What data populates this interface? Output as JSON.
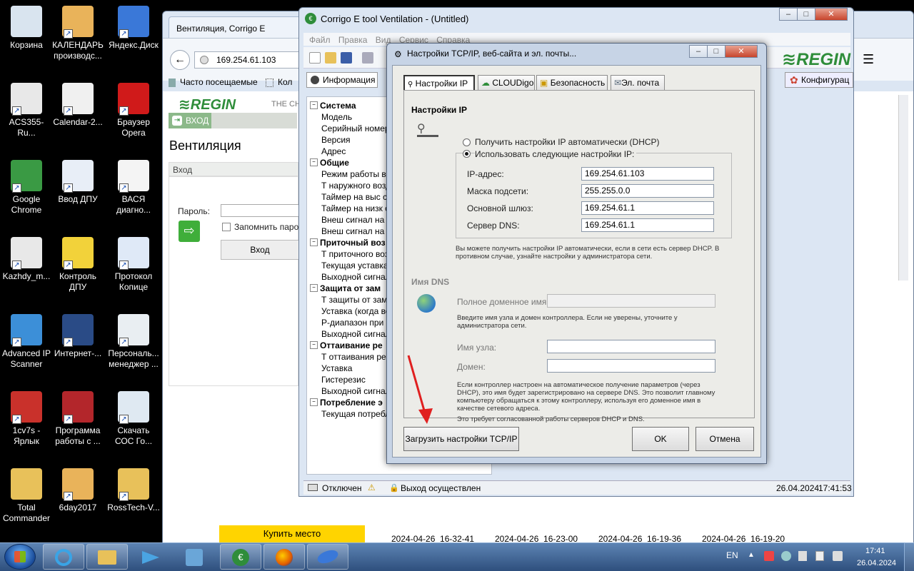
{
  "desktop": {
    "icons": [
      {
        "label": "Корзина",
        "icon": "recycle-bin-icon",
        "color": "#d9e4ef"
      },
      {
        "label": "КАЛЕНДАРЬ производс...",
        "icon": "calendar-icon",
        "color": "#e9b35a"
      },
      {
        "label": "Яндекс.Диск",
        "icon": "yandex-disk-icon",
        "color": "#3a78d8"
      },
      {
        "label": "ACS355-Ru...",
        "icon": "pdf-icon",
        "color": "#e8e8e8"
      },
      {
        "label": "Calendar-2...",
        "icon": "calendar-icon",
        "color": "#f0f0f0"
      },
      {
        "label": "Браузер Opera",
        "icon": "opera-icon",
        "color": "#d01a1a"
      },
      {
        "label": "Google Chrome",
        "icon": "chrome-icon",
        "color": "#3a9a44"
      },
      {
        "label": "Ввод ДПУ",
        "icon": "documents-icon",
        "color": "#e8eef7"
      },
      {
        "label": "ВАСЯ диагно...",
        "icon": "vasya-icon",
        "color": "#f4f4f4"
      },
      {
        "label": "Kazhdy_m...",
        "icon": "pdf-icon",
        "color": "#e8e8e8"
      },
      {
        "label": "Контроль ДПУ",
        "icon": "bee-icon",
        "color": "#f2d23a"
      },
      {
        "label": "Протокол Копице",
        "icon": "word-doc-icon",
        "color": "#dfe9f7"
      },
      {
        "label": "Advanced IP Scanner",
        "icon": "network-scanner-icon",
        "color": "#3c8fd8"
      },
      {
        "label": "Интернет-...",
        "icon": "internet-icon",
        "color": "#2a4b86"
      },
      {
        "label": "Персональ... менеджер ...",
        "icon": "manager-icon",
        "color": "#e9eef2"
      },
      {
        "label": "1cv7s - Ярлык",
        "icon": "1c-icon",
        "color": "#c9312b"
      },
      {
        "label": "Программа работы с ...",
        "icon": "program-icon",
        "color": "#b3262b"
      },
      {
        "label": "Скачать СОС Го...",
        "icon": "download-icon",
        "color": "#dfe9f2"
      },
      {
        "label": "Total Commander",
        "icon": "folder-icon",
        "color": "#e8c15a"
      },
      {
        "label": "6day2017",
        "icon": "calendar-icon",
        "color": "#e9b35a"
      },
      {
        "label": "RossTech-V...",
        "icon": "archive-icon",
        "color": "#e8c15a"
      }
    ]
  },
  "browser": {
    "tab_title": "Вентиляция, Corrigo E",
    "address": "169.254.61.103",
    "bookmarks": [
      "Часто посещаемые",
      "Кол"
    ],
    "logo": "REGIN",
    "logo_sub": "THE CH",
    "login_button_small": "ВХОД",
    "page_heading": "Вентиляция",
    "section_label": "Вход",
    "password_label": "Пароль:",
    "remember_label": "Запомнить паро",
    "login_button": "Вход",
    "buy_button": "Купить место",
    "timestamps": [
      "2024-04-26_16-32-41",
      "2024-04-26_16-23-00",
      "2024-04-26_16-19-36",
      "2024-04-26_16-19-20"
    ]
  },
  "app": {
    "title": "Corrigo E tool Ventilation - (Untitled)",
    "menu": [
      "Файл",
      "Правка",
      "Вид",
      "Сервис",
      "Справка"
    ],
    "info_tab": "Информация",
    "config_tab": "Конфигурац",
    "logo": "REGIN",
    "tree": [
      {
        "text": "Система",
        "head": true
      },
      {
        "text": "Модель"
      },
      {
        "text": "Серийный номер"
      },
      {
        "text": "Версия"
      },
      {
        "text": "Адрес"
      },
      {
        "text": "Общие",
        "head": true
      },
      {
        "text": "Режим работы ве"
      },
      {
        "text": "Т наружного возд"
      },
      {
        "text": "Таймер на выс ск"
      },
      {
        "text": "Таймер на низк ск"
      },
      {
        "text": "Внеш сигнал на в"
      },
      {
        "text": "Внеш сигнал на н"
      },
      {
        "text": "Приточный воз",
        "head": true
      },
      {
        "text": "Т приточного воз"
      },
      {
        "text": "Текущая уставка"
      },
      {
        "text": "Выходной сигнал"
      },
      {
        "text": "Защита от зам",
        "head": true
      },
      {
        "text": "Т защиты от заме"
      },
      {
        "text": "Уставка (когда ве"
      },
      {
        "text": "Р-диапазон при р"
      },
      {
        "text": "Выходной сигнал"
      },
      {
        "text": "Оттаивание ре",
        "head": true
      },
      {
        "text": "Т оттаивания рек"
      },
      {
        "text": "Уставка"
      },
      {
        "text": "Гистерезис"
      },
      {
        "text": "Выходной сигнал"
      },
      {
        "text": "Потребление э",
        "head": true
      },
      {
        "text": "Текущая потребл"
      }
    ],
    "status": {
      "connection": "Отключен",
      "login": "Выход осуществлен",
      "date": "26.04.2024",
      "time": "17:41:53"
    }
  },
  "dialog": {
    "title": "Настройки TCP/IP, веб-сайта и эл. почты...",
    "tabs": [
      "Настройки IP",
      "CLOUDigo",
      "Безопасность",
      "Эл. почта"
    ],
    "ip_section": "Настройки IP",
    "radio_auto": "Получить настройки IP автоматически (DHCP)",
    "radio_manual": "Использовать следующие настройки IP:",
    "ip_label": "IP-адрес:",
    "ip_value": "169.254.61.103",
    "mask_label": "Маска подсети:",
    "mask_value": "255.255.0.0",
    "gateway_label": "Основной шлюз:",
    "gateway_value": "169.254.61.1",
    "dns_label": "Сервер DNS:",
    "dns_value": "169.254.61.1",
    "dhcp_note": "Вы можете получить настройки IP автоматически, если в сети есть сервер DHCP. В противном случае, узнайте настройки у администратора сети.",
    "dns_section": "Имя DNS",
    "fqdn_label": "Полное доменное имя",
    "fqdn_value": "",
    "host_hint": "Введите имя узла и домен контроллера. Если не уверены, уточните у администратора сети.",
    "hostname_label": "Имя узла:",
    "hostname_value": "",
    "domain_label": "Домен:",
    "domain_value": "",
    "dns_note": "Если контроллер настроен на автоматическое получение параметров (через DHCP), это имя будет зарегистрировано на сервере DNS. Это позволит главному компьютеру обращаться к этому контроллеру, используя его доменное имя в качестве сетевого адреса.",
    "dns_note2": "Это требует согласованной работы серверов DHCP и DNS.",
    "load_button": "Загрузить настройки TCP/IP",
    "ok_button": "OK",
    "cancel_button": "Отмена"
  },
  "taskbar": {
    "lang": "EN",
    "time": "17:41",
    "date": "26.04.2024"
  },
  "colors": {
    "regin_green": "#2f8d3a",
    "arrow_red": "#e02020",
    "dialog_bg": "#ecece8"
  }
}
